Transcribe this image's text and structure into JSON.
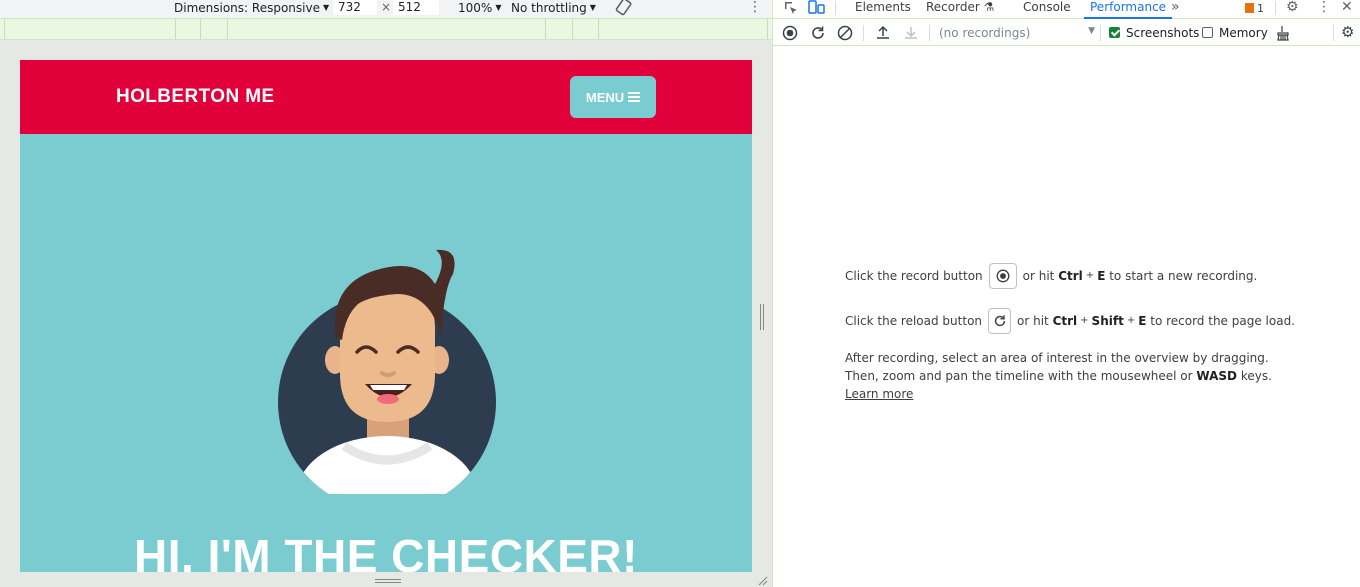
{
  "device_toolbar": {
    "dimensions_label": "Dimensions: Responsive",
    "width": "732",
    "times": "×",
    "height": "512",
    "zoom": "100%",
    "throttling": "No throttling"
  },
  "site": {
    "brand": "HOLBERTON ME",
    "menu_label": "MENU",
    "hero_title": "HI, I'M THE CHECKER!",
    "colors": {
      "header": "#e2003b",
      "hero": "#7accd1"
    }
  },
  "devtools": {
    "tabs": [
      "Elements",
      "Recorder",
      "Console",
      "Performance"
    ],
    "active_tab": "Performance",
    "issues_count": "1",
    "perf_toolbar": {
      "recordings_placeholder": "(no recordings)",
      "screenshots_label": "Screenshots",
      "screenshots_checked": true,
      "memory_label": "Memory",
      "memory_checked": false
    },
    "landing": {
      "record_pre": "Click the record button",
      "record_mid": "or hit",
      "key_ctrl": "Ctrl",
      "plus": "+",
      "key_e": "E",
      "record_post": "to start a new recording.",
      "reload_pre": "Click the reload button",
      "reload_mid": "or hit",
      "key_shift": "Shift",
      "reload_post": "to record the page load.",
      "para_pre": "After recording, select an area of interest in the overview by dragging. Then, zoom and pan the timeline with the mousewheel or",
      "key_wasd": "WASD",
      "para_post": "keys.",
      "learn_more": "Learn more"
    }
  }
}
